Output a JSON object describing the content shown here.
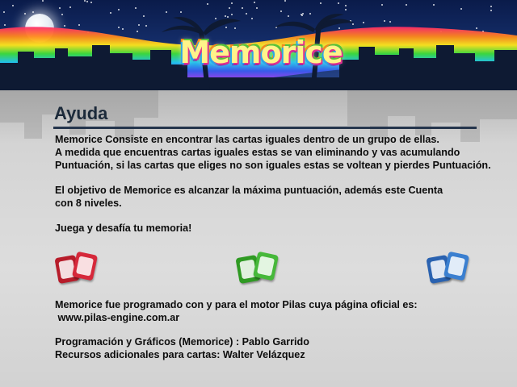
{
  "header": {
    "logo_text": "Memorice"
  },
  "help": {
    "title": "Ayuda",
    "para1_line1": "Memorice Consiste en encontrar las cartas iguales dentro de un grupo de ellas.",
    "para1_line2": "A medida que encuentras cartas iguales estas se van eliminando y vas acumulando",
    "para1_line3": "Puntuación, si las cartas que eliges no son iguales estas se voltean y pierdes Puntuación.",
    "para2_line1": "El objetivo de Memorice es alcanzar la máxima puntuación,  además este Cuenta",
    "para2_line2": "con 8 niveles.",
    "para3": "Juega y desafía tu memoria!",
    "engine_line1": "Memorice fue programado con y para  el motor Pilas cuya página oficial es:",
    "engine_line2": " www.pilas-engine.com.ar",
    "credits_line1": "Programación y Gráficos (Memorice) : Pablo Garrido",
    "credits_line2": "Recursos adicionales para cartas: Walter Velázquez"
  },
  "decor": {
    "card_icons": [
      {
        "name": "red-cards-icon",
        "color": "#c8202e"
      },
      {
        "name": "green-cards-icon",
        "color": "#3aa52c"
      },
      {
        "name": "blue-cards-icon",
        "color": "#2f6fbf"
      }
    ]
  }
}
